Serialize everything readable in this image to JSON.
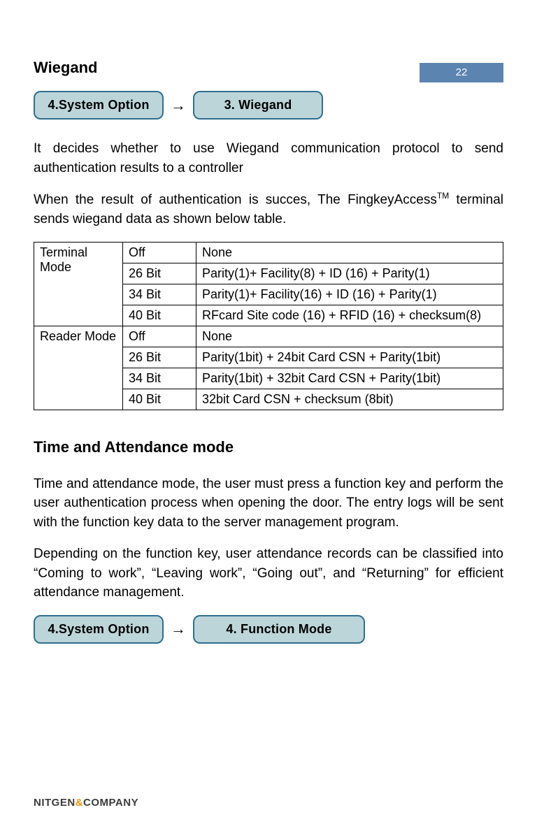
{
  "page_number": "22",
  "wiegand": {
    "title": "Wiegand",
    "nav": {
      "box1": "4.System Option",
      "arrow": "→",
      "box2": "3. Wiegand"
    },
    "para1": "It decides whether to use Wiegand communication protocol to send authentication results to a controller",
    "para2a": "When the result of authentication is succes, The FingkeyAccess",
    "para2sup": "TM",
    "para2b": " terminal sends wiegand data as shown below table.",
    "table": {
      "rows": [
        {
          "mode": "Terminal Mode",
          "rowspan": 4,
          "bit": "Off",
          "desc": "None"
        },
        {
          "bit": "26 Bit",
          "desc": "Parity(1)+ Facility(8) + ID (16) + Parity(1)"
        },
        {
          "bit": "34 Bit",
          "desc": "Parity(1)+ Facility(16) + ID (16) + Parity(1)"
        },
        {
          "bit": "40 Bit",
          "desc": "RFcard Site code (16) + RFID (16) + checksum(8)"
        },
        {
          "mode": "Reader Mode",
          "rowspan": 4,
          "bit": "Off",
          "desc": "None"
        },
        {
          "bit": "26 Bit",
          "desc": "Parity(1bit) + 24bit Card CSN + Parity(1bit)"
        },
        {
          "bit": "34 Bit",
          "desc": "Parity(1bit) + 32bit Card CSN + Parity(1bit)"
        },
        {
          "bit": "40 Bit",
          "desc": "32bit Card CSN + checksum (8bit)"
        }
      ]
    }
  },
  "ta": {
    "title": "Time and Attendance mode",
    "para1": "Time and attendance mode, the user must press a function key and perform the user authentication process when opening the door. The entry logs will be sent with the function key data to the server management program.",
    "para2": "Depending on the function key, user attendance records can be classified into “Coming to work”, “Leaving work”, “Going out”, and “Returning” for efficient attendance management.",
    "nav": {
      "box1": "4.System Option",
      "arrow": "→",
      "box2": "4. Function Mode"
    }
  },
  "footer": {
    "part1": "NITGEN",
    "amp": "&",
    "part2": "COMPANY"
  }
}
